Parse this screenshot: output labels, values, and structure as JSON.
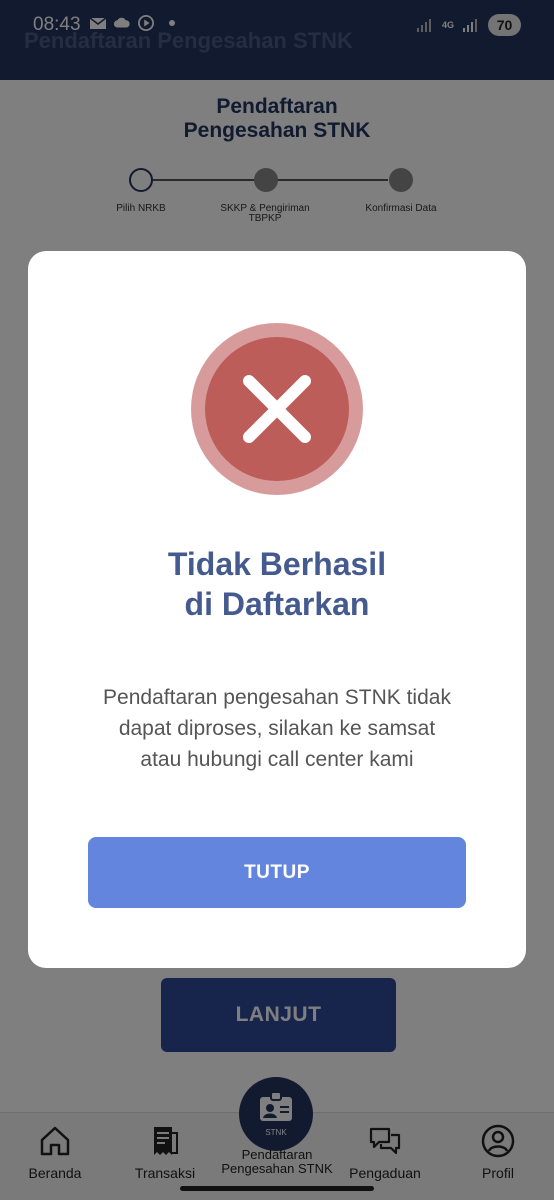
{
  "status_bar": {
    "time": "08:43",
    "network": "4G",
    "battery": "70"
  },
  "header": {
    "title": "Pendaftaran Pengesahan STNK"
  },
  "page": {
    "title_line1": "Pendaftaran",
    "title_line2": "Pengesahan STNK",
    "steps": [
      {
        "label": "Pilih NRKB"
      },
      {
        "label": "SKKP & Pengiriman TBPKP"
      },
      {
        "label": "Konfirmasi Data"
      }
    ],
    "next_label": "LANJUT"
  },
  "modal": {
    "title_line1": "Tidak Berhasil",
    "title_line2": "di Daftarkan",
    "message": "Pendaftaran pengesahan STNK tidak dapat diproses, silakan ke samsat atau hubungi call center kami",
    "close_label": "TUTUP",
    "icon": "close-x-icon"
  },
  "bottom_nav": {
    "items": [
      {
        "label": "Beranda",
        "icon": "home-icon"
      },
      {
        "label": "Transaksi",
        "icon": "receipt-icon"
      },
      {
        "label": "Pendaftaran Pengesahan STNK",
        "icon": "stnk-card-icon",
        "badge": "STNK"
      },
      {
        "label": "Pengaduan",
        "icon": "chat-icon"
      },
      {
        "label": "Profil",
        "icon": "profile-icon"
      }
    ]
  },
  "colors": {
    "primary": "#23355f",
    "accent_button": "#6485dd",
    "error": "#bd5d5a",
    "title": "#455a8f"
  }
}
